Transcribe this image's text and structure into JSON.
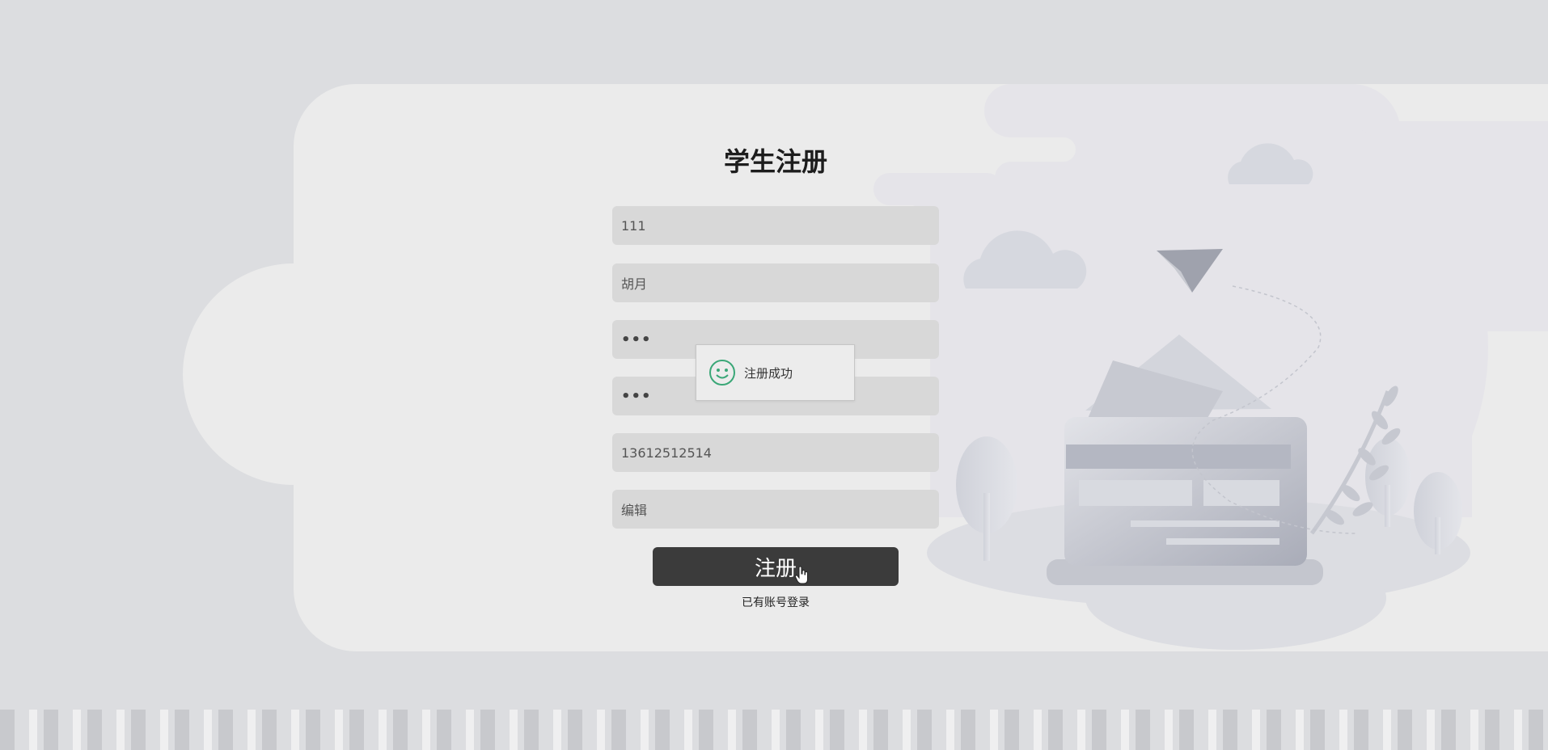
{
  "page": {
    "title": "学生注册"
  },
  "form": {
    "fields": [
      {
        "name": "account",
        "value": "111"
      },
      {
        "name": "name",
        "value": "胡月"
      },
      {
        "name": "password",
        "value": "•••"
      },
      {
        "name": "confirm_password",
        "value": "•••"
      },
      {
        "name": "phone",
        "value": "13612512514"
      },
      {
        "name": "note",
        "value": "编辑"
      }
    ],
    "submit_label": "注册",
    "login_link": "已有账号登录"
  },
  "toast": {
    "message": "注册成功",
    "icon": "smile-icon"
  },
  "colors": {
    "background": "#dcdde0",
    "panel": "#ebebeb",
    "field": "#d8d8d8",
    "button": "#3b3b3b",
    "toast_icon": "#3aa777"
  }
}
